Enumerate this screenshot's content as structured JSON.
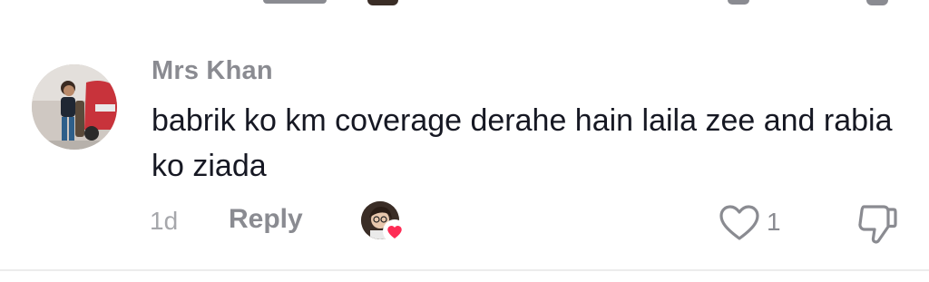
{
  "comment": {
    "username": "Mrs Khan",
    "text": "babrik ko km coverage derahe hain laila zee and rabia ko ziada",
    "time_ago": "1d",
    "reply_label": "Reply",
    "like_count": "1"
  },
  "colors": {
    "primary_text": "#161823",
    "secondary_text": "#8a8b91",
    "heart": "#fe2c55"
  },
  "icons": {
    "like": "heart-outline-icon",
    "dislike": "thumbs-down-icon",
    "creator_liked": "heart-filled-icon"
  }
}
